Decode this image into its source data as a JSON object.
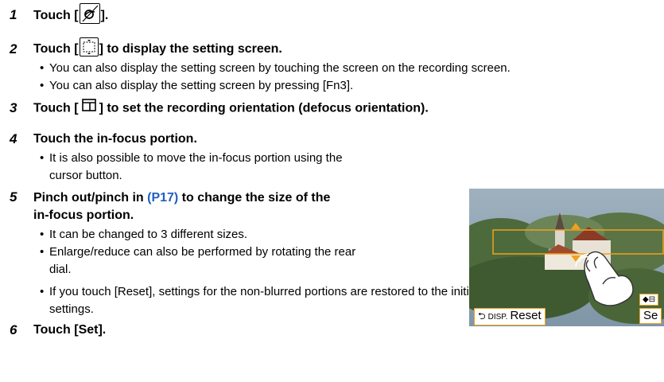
{
  "steps": [
    {
      "num": "1",
      "pre": "Touch [",
      "post": "]."
    },
    {
      "num": "2",
      "pre": "Touch [",
      "post": "] to display the setting screen.",
      "bullets": [
        "You can also display the setting screen by touching the screen on the recording screen.",
        "You can also display the setting screen by pressing [Fn3]."
      ]
    },
    {
      "num": "3",
      "pre": "Touch [",
      "post": "] to set the recording orientation (defocus orientation)."
    },
    {
      "num": "4",
      "text": "Touch the in-focus portion.",
      "bullets": [
        "It is also possible to move the in-focus portion using the",
        "cursor button."
      ]
    },
    {
      "num": "5",
      "line1_pre": "Pinch out/pinch in ",
      "line1_link": "(P17)",
      "line1_post": " to change the size of the",
      "line2": "in-focus portion.",
      "bullets": [
        "It can be changed to 3 different sizes.",
        "Enlarge/reduce can also be performed by rotating the rear",
        "dial.",
        "If you touch [Reset], settings for the non-blurred portions are restored to the initial",
        "settings."
      ]
    },
    {
      "num": "6",
      "text": "Touch [Set]."
    }
  ],
  "bullet_char": "•",
  "camera_screen": {
    "disp_label": "DISP.",
    "reset_label": "Reset",
    "set_label": "Se",
    "back_icon": "return-arrow-icon",
    "accent_color": "#f0a21b"
  }
}
